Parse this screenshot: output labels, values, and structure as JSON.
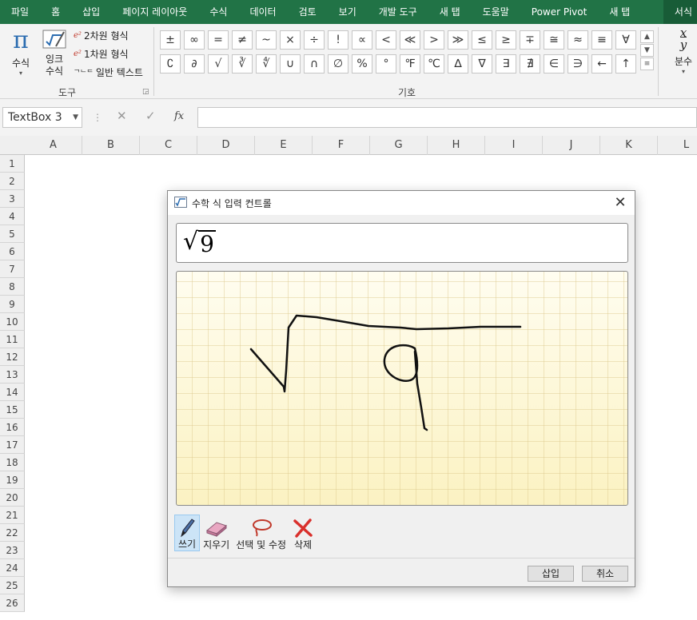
{
  "ribbon": {
    "tabs": [
      "파일",
      "홈",
      "삽입",
      "페이지 레이아웃",
      "수식",
      "데이터",
      "검토",
      "보기",
      "개발 도구",
      "새 탭",
      "도움말",
      "Power Pivot",
      "새 탭",
      "서식"
    ],
    "tools_group": {
      "label": "도구",
      "equation": "수식",
      "ink_equation": "잉크 수식",
      "professional": "2차원 형식",
      "linear": "1차원 형식",
      "normal_text": "일반 텍스트"
    },
    "symbols_group": {
      "label": "기호",
      "row1": [
        "±",
        "∞",
        "=",
        "≠",
        "~",
        "×",
        "÷",
        "!",
        "∝",
        "<",
        "≪",
        ">",
        "≫",
        "≤",
        "≥",
        "∓",
        "≅",
        "≈",
        "≡",
        "∀"
      ],
      "row2": [
        "∁",
        "∂",
        "√",
        "∛",
        "∜",
        "∪",
        "∩",
        "∅",
        "%",
        "°",
        "℉",
        "℃",
        "∆",
        "∇",
        "∃",
        "∄",
        "∈",
        "∋",
        "←",
        "↑"
      ]
    },
    "fraction_label": "분수"
  },
  "formula_bar": {
    "name_box": "TextBox 3",
    "fx": "fx"
  },
  "grid": {
    "columns": [
      "A",
      "B",
      "C",
      "D",
      "E",
      "F",
      "G",
      "H",
      "I",
      "J",
      "K",
      "L"
    ],
    "rows": [
      "1",
      "2",
      "3",
      "4",
      "5",
      "6",
      "7",
      "8",
      "9",
      "10",
      "11",
      "12",
      "13",
      "14",
      "15",
      "16",
      "17",
      "18",
      "19",
      "20",
      "21",
      "22",
      "23",
      "24",
      "25",
      "26"
    ]
  },
  "dialog": {
    "title": "수학 식 입력 컨트롤",
    "preview": {
      "radicand": "9"
    },
    "tools": [
      "쓰기",
      "지우기",
      "선택 및 수정",
      "삭제"
    ],
    "insert": "삽입",
    "cancel": "취소"
  },
  "colors": {
    "excel_green": "#217346",
    "canvas_top": "#fffdf0",
    "canvas_bottom": "#fbf2c2",
    "delete_red": "#d9302c"
  }
}
